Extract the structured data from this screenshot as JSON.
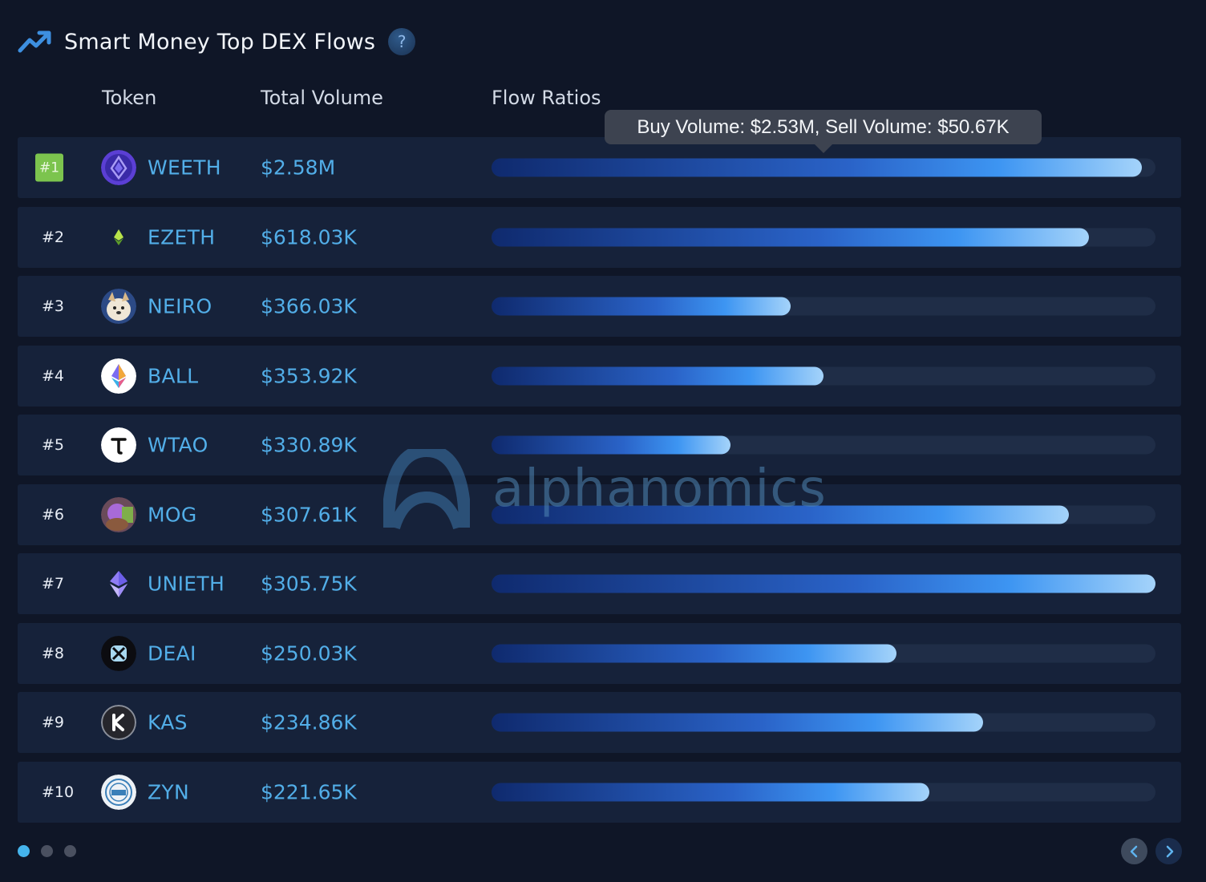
{
  "header": {
    "title": "Smart Money Top DEX Flows",
    "help_label": "?"
  },
  "columns": {
    "token": "Token",
    "total_volume": "Total Volume",
    "flow_ratios": "Flow Ratios"
  },
  "tooltip": {
    "text": "Buy Volume: $2.53M, Sell Volume: $50.67K"
  },
  "watermark": {
    "text": "alphanomics"
  },
  "rows": [
    {
      "rank": "#1",
      "symbol": "WEETH",
      "volume": "$2.58M",
      "flow_ratio": 0.98
    },
    {
      "rank": "#2",
      "symbol": "EZETH",
      "volume": "$618.03K",
      "flow_ratio": 0.9
    },
    {
      "rank": "#3",
      "symbol": "NEIRO",
      "volume": "$366.03K",
      "flow_ratio": 0.45
    },
    {
      "rank": "#4",
      "symbol": "BALL",
      "volume": "$353.92K",
      "flow_ratio": 0.5
    },
    {
      "rank": "#5",
      "symbol": "WTAO",
      "volume": "$330.89K",
      "flow_ratio": 0.36
    },
    {
      "rank": "#6",
      "symbol": "MOG",
      "volume": "$307.61K",
      "flow_ratio": 0.87
    },
    {
      "rank": "#7",
      "symbol": "UNIETH",
      "volume": "$305.75K",
      "flow_ratio": 1.0
    },
    {
      "rank": "#8",
      "symbol": "DEAI",
      "volume": "$250.03K",
      "flow_ratio": 0.61
    },
    {
      "rank": "#9",
      "symbol": "KAS",
      "volume": "$234.86K",
      "flow_ratio": 0.74
    },
    {
      "rank": "#10",
      "symbol": "ZYN",
      "volume": "$221.65K",
      "flow_ratio": 0.66
    }
  ],
  "pagination": {
    "pages": 3,
    "active_page": 1
  },
  "colors": {
    "background": "#0f1627",
    "row_background": "#16223a",
    "accent_text": "#52aee8",
    "rank_badge": "#7cc44e"
  }
}
